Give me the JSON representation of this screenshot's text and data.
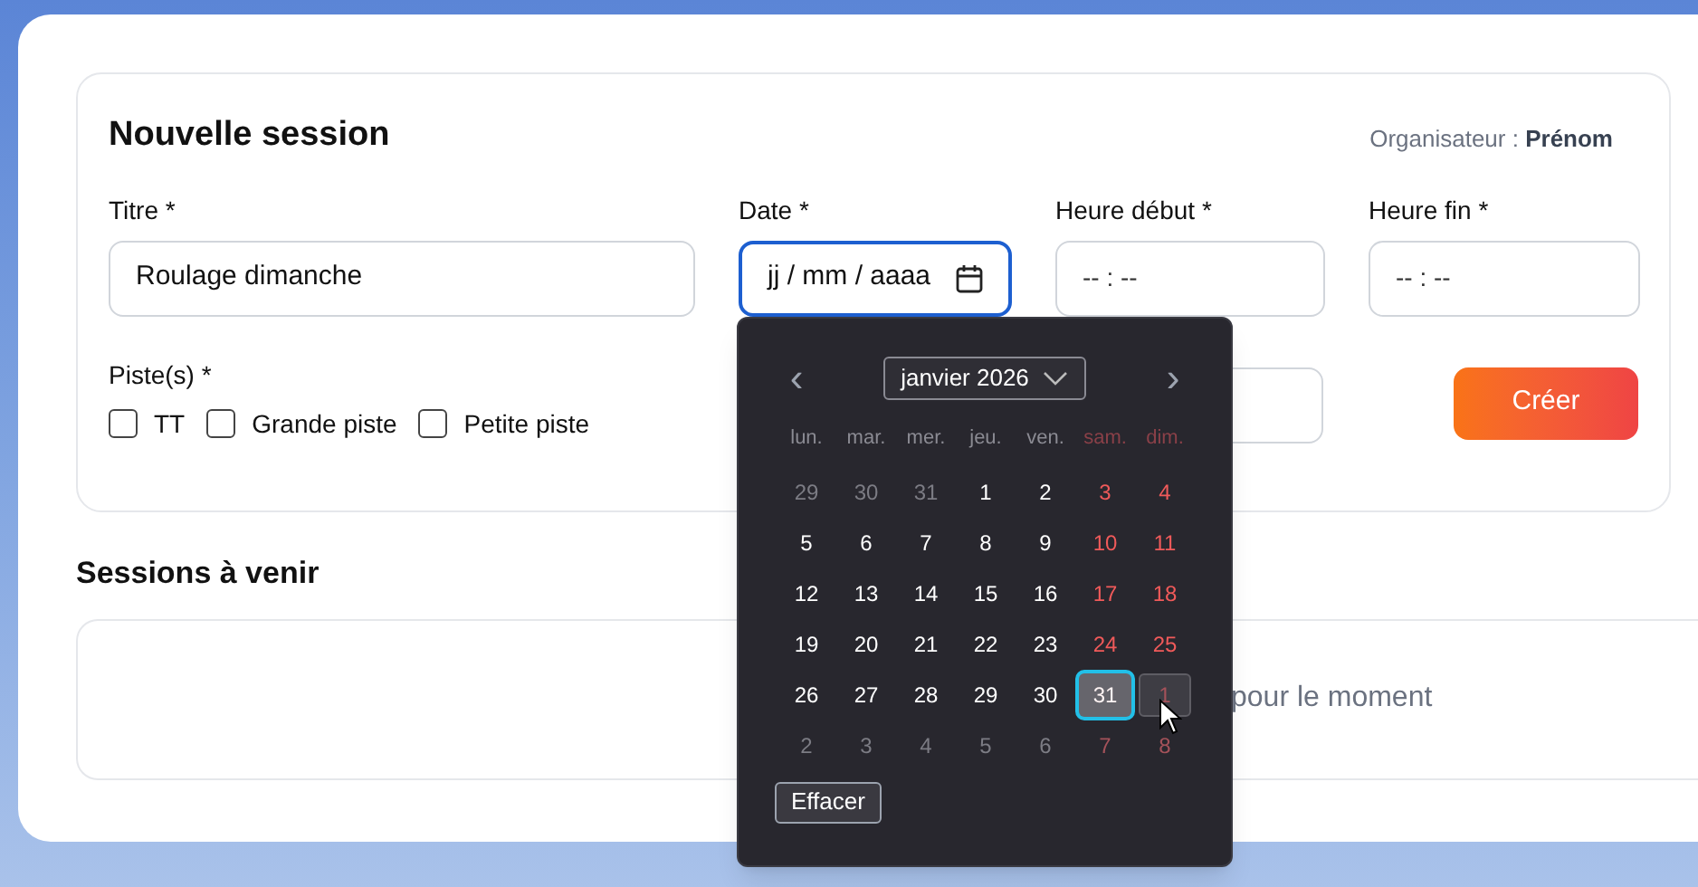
{
  "form": {
    "title": "Nouvelle session",
    "organizer_label": "Organisateur :",
    "organizer_name": "Prénom",
    "fields": [
      {
        "label": "Titre *",
        "value": "Roulage dimanche",
        "kind": "text",
        "focused": false
      },
      {
        "label": "Date *",
        "value": "jj / mm / aaaa",
        "kind": "date",
        "focused": true
      },
      {
        "label": "Heure début *",
        "value": "-- : --",
        "kind": "time",
        "focused": false
      },
      {
        "label": "Heure fin *",
        "value": "-- : --",
        "kind": "time",
        "focused": false
      }
    ],
    "tracks_label": "Piste(s) *",
    "tracks": [
      {
        "label": "TT",
        "checked": false
      },
      {
        "label": "Grande piste",
        "checked": false
      },
      {
        "label": "Petite piste",
        "checked": false
      }
    ],
    "submit": "Créer"
  },
  "upcoming": {
    "title": "Sessions à venir",
    "empty_text": "pour le moment"
  },
  "calendar": {
    "month": "janvier 2026",
    "prev": "‹",
    "next": "›",
    "clear": "Effacer",
    "weekdays": [
      {
        "label": "lun.",
        "weekend": false
      },
      {
        "label": "mar.",
        "weekend": false
      },
      {
        "label": "mer.",
        "weekend": false
      },
      {
        "label": "jeu.",
        "weekend": false
      },
      {
        "label": "ven.",
        "weekend": false
      },
      {
        "label": "sam.",
        "weekend": true
      },
      {
        "label": "dim.",
        "weekend": true
      }
    ],
    "days": [
      {
        "label": "29",
        "outside": true,
        "weekend": false,
        "selected": false,
        "hovered": false
      },
      {
        "label": "30",
        "outside": true,
        "weekend": false,
        "selected": false,
        "hovered": false
      },
      {
        "label": "31",
        "outside": true,
        "weekend": false,
        "selected": false,
        "hovered": false
      },
      {
        "label": "1",
        "outside": false,
        "weekend": false,
        "selected": false,
        "hovered": false
      },
      {
        "label": "2",
        "outside": false,
        "weekend": false,
        "selected": false,
        "hovered": false
      },
      {
        "label": "3",
        "outside": false,
        "weekend": true,
        "selected": false,
        "hovered": false
      },
      {
        "label": "4",
        "outside": false,
        "weekend": true,
        "selected": false,
        "hovered": false
      },
      {
        "label": "5",
        "outside": false,
        "weekend": false,
        "selected": false,
        "hovered": false
      },
      {
        "label": "6",
        "outside": false,
        "weekend": false,
        "selected": false,
        "hovered": false
      },
      {
        "label": "7",
        "outside": false,
        "weekend": false,
        "selected": false,
        "hovered": false
      },
      {
        "label": "8",
        "outside": false,
        "weekend": false,
        "selected": false,
        "hovered": false
      },
      {
        "label": "9",
        "outside": false,
        "weekend": false,
        "selected": false,
        "hovered": false
      },
      {
        "label": "10",
        "outside": false,
        "weekend": true,
        "selected": false,
        "hovered": false
      },
      {
        "label": "11",
        "outside": false,
        "weekend": true,
        "selected": false,
        "hovered": false
      },
      {
        "label": "12",
        "outside": false,
        "weekend": false,
        "selected": false,
        "hovered": false
      },
      {
        "label": "13",
        "outside": false,
        "weekend": false,
        "selected": false,
        "hovered": false
      },
      {
        "label": "14",
        "outside": false,
        "weekend": false,
        "selected": false,
        "hovered": false
      },
      {
        "label": "15",
        "outside": false,
        "weekend": false,
        "selected": false,
        "hovered": false
      },
      {
        "label": "16",
        "outside": false,
        "weekend": false,
        "selected": false,
        "hovered": false
      },
      {
        "label": "17",
        "outside": false,
        "weekend": true,
        "selected": false,
        "hovered": false
      },
      {
        "label": "18",
        "outside": false,
        "weekend": true,
        "selected": false,
        "hovered": false
      },
      {
        "label": "19",
        "outside": false,
        "weekend": false,
        "selected": false,
        "hovered": false
      },
      {
        "label": "20",
        "outside": false,
        "weekend": false,
        "selected": false,
        "hovered": false
      },
      {
        "label": "21",
        "outside": false,
        "weekend": false,
        "selected": false,
        "hovered": false
      },
      {
        "label": "22",
        "outside": false,
        "weekend": false,
        "selected": false,
        "hovered": false
      },
      {
        "label": "23",
        "outside": false,
        "weekend": false,
        "selected": false,
        "hovered": false
      },
      {
        "label": "24",
        "outside": false,
        "weekend": true,
        "selected": false,
        "hovered": false
      },
      {
        "label": "25",
        "outside": false,
        "weekend": true,
        "selected": false,
        "hovered": false
      },
      {
        "label": "26",
        "outside": false,
        "weekend": false,
        "selected": false,
        "hovered": false
      },
      {
        "label": "27",
        "outside": false,
        "weekend": false,
        "selected": false,
        "hovered": false
      },
      {
        "label": "28",
        "outside": false,
        "weekend": false,
        "selected": false,
        "hovered": false
      },
      {
        "label": "29",
        "outside": false,
        "weekend": false,
        "selected": false,
        "hovered": false
      },
      {
        "label": "30",
        "outside": false,
        "weekend": false,
        "selected": false,
        "hovered": false
      },
      {
        "label": "31",
        "outside": false,
        "weekend": true,
        "selected": true,
        "hovered": false
      },
      {
        "label": "1",
        "outside": true,
        "weekend": true,
        "selected": false,
        "hovered": true
      },
      {
        "label": "2",
        "outside": true,
        "weekend": false,
        "selected": false,
        "hovered": false
      },
      {
        "label": "3",
        "outside": true,
        "weekend": false,
        "selected": false,
        "hovered": false
      },
      {
        "label": "4",
        "outside": true,
        "weekend": false,
        "selected": false,
        "hovered": false
      },
      {
        "label": "5",
        "outside": true,
        "weekend": false,
        "selected": false,
        "hovered": false
      },
      {
        "label": "6",
        "outside": true,
        "weekend": false,
        "selected": false,
        "hovered": false
      },
      {
        "label": "7",
        "outside": true,
        "weekend": true,
        "selected": false,
        "hovered": false
      },
      {
        "label": "8",
        "outside": true,
        "weekend": true,
        "selected": false,
        "hovered": false
      }
    ]
  }
}
